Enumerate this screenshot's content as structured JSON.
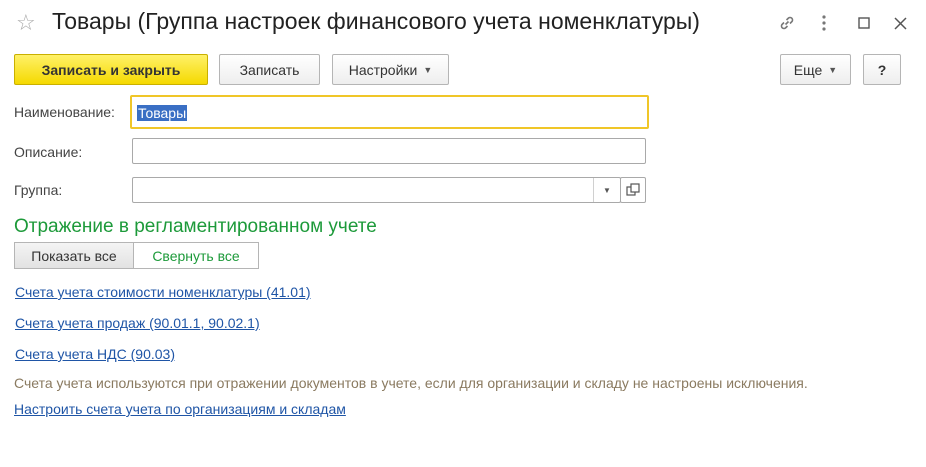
{
  "window": {
    "title": "Товары (Группа настроек финансового учета номенклатуры)",
    "icons": {
      "favorite": "star-icon",
      "link": "link-icon",
      "more": "kebab-icon",
      "maximize": "maximize-icon",
      "close": "close-icon"
    }
  },
  "toolbar": {
    "save_close_label": "Записать и закрыть",
    "save_label": "Записать",
    "settings_label": "Настройки",
    "more_label": "Еще",
    "help_label": "?"
  },
  "form": {
    "name_label": "Наименование:",
    "name_value": "Товары",
    "description_label": "Описание:",
    "description_value": "",
    "group_label": "Группа:",
    "group_value": ""
  },
  "section": {
    "title": "Отражение в регламентированном учете",
    "show_all_label": "Показать все",
    "collapse_all_label": "Свернуть все",
    "links": [
      "Счета учета стоимости номенклатуры (41.01)",
      "Счета учета продаж (90.01.1, 90.02.1)",
      "Счета учета НДС (90.03)"
    ],
    "note": "Счета учета используются при отражении документов в учете, если для организации и складу не настроены исключения.",
    "configure_link": "Настроить счета учета по организациям и складам"
  },
  "colors": {
    "primary_button": "#f5d900",
    "section_title": "#1d9a3a",
    "link": "#1f55a6",
    "focus_border": "#f0c628"
  }
}
